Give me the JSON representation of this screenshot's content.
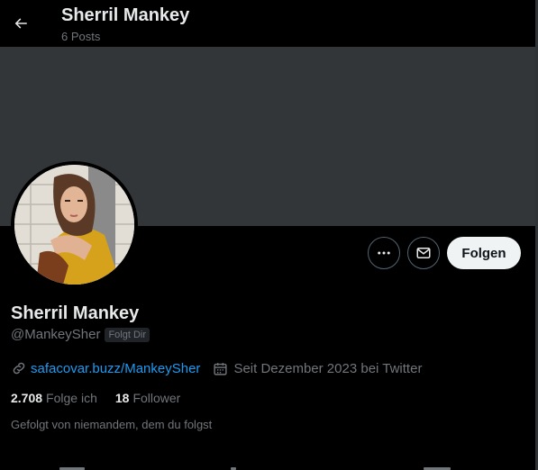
{
  "header": {
    "back_icon": "arrow-left-icon",
    "title": "Sherril Mankey",
    "post_count": "6 Posts"
  },
  "colors": {
    "background": "#000000",
    "banner": "#333639",
    "text_primary": "#e7e9ea",
    "text_secondary": "#71767b",
    "link": "#1d9bf0",
    "follow_button_bg": "#eff3f4"
  },
  "actions": {
    "more_icon": "ellipsis-icon",
    "message_icon": "envelope-icon",
    "follow_label": "Folgen"
  },
  "profile": {
    "name": "Sherril Mankey",
    "handle": "@MankeySher",
    "follows_you_badge": "Folgt Dir",
    "link_icon": "link-icon",
    "website": "safacovar.buzz/MankeySher",
    "calendar_icon": "calendar-icon",
    "joined": "Seit Dezember 2023 bei Twitter",
    "following_count": "2.708",
    "following_label": "Folge ich",
    "follower_count": "18",
    "follower_label": "Follower",
    "followed_by_text": "Gefolgt von niemandem, dem du folgst"
  }
}
